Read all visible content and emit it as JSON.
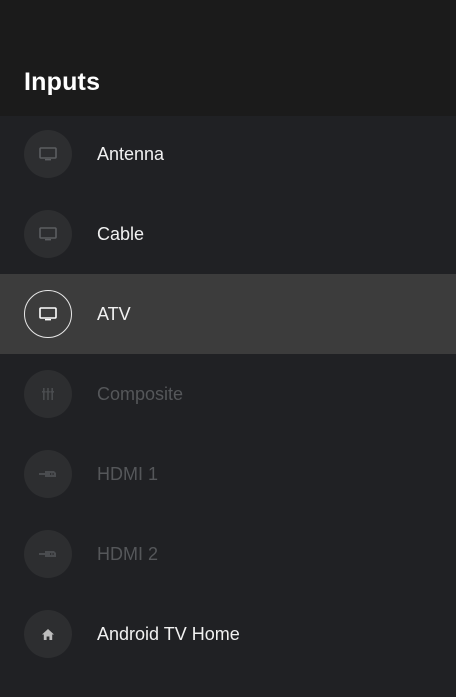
{
  "panel": {
    "title": "Inputs"
  },
  "inputs": [
    {
      "label": "Antenna",
      "icon": "tv-icon",
      "state": "normal"
    },
    {
      "label": "Cable",
      "icon": "tv-icon",
      "state": "normal"
    },
    {
      "label": "ATV",
      "icon": "tv-icon",
      "state": "focused"
    },
    {
      "label": "Composite",
      "icon": "composite-icon",
      "state": "disabled"
    },
    {
      "label": "HDMI 1",
      "icon": "hdmi-icon",
      "state": "disabled"
    },
    {
      "label": "HDMI 2",
      "icon": "hdmi-icon",
      "state": "disabled"
    },
    {
      "label": "Android TV Home",
      "icon": "home-icon",
      "state": "normal"
    }
  ],
  "colors": {
    "background": "#202124",
    "header": "#1b1b1b",
    "focused_row": "#3c3c3c",
    "icon_circle": "#2d2e30",
    "text": "#f1f1f1",
    "disabled_text": "#55575a"
  }
}
